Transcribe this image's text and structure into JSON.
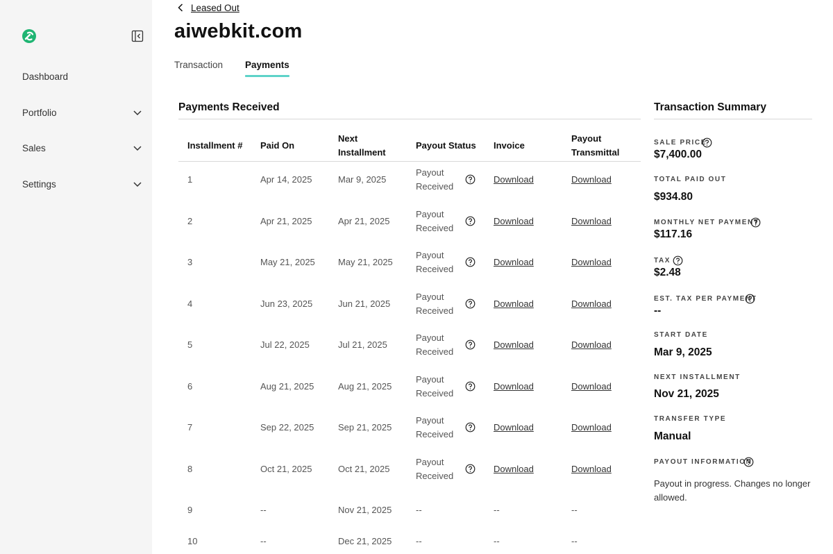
{
  "sidebar": {
    "collapse_icon": "sidebar-collapse-icon",
    "items": [
      {
        "label": "Dashboard",
        "has_chevron": false
      },
      {
        "label": "Portfolio",
        "has_chevron": true
      },
      {
        "label": "Sales",
        "has_chevron": true
      },
      {
        "label": "Settings",
        "has_chevron": true
      }
    ]
  },
  "header": {
    "back_label": "Leased Out",
    "title": "aiwebkit.com",
    "tabs": [
      {
        "label": "Transaction",
        "active": false
      },
      {
        "label": "Payments",
        "active": true
      }
    ]
  },
  "payments": {
    "title": "Payments Received",
    "columns": {
      "installment": "Installment #",
      "paid_on": "Paid On",
      "next_installment_1": "Next",
      "next_installment_2": "Installment",
      "payout_status": "Payout Status",
      "invoice": "Invoice",
      "payout_transmittal_1": "Payout",
      "payout_transmittal_2": "Transmittal"
    },
    "rows": [
      {
        "num": "1",
        "paid_on": "Apr 14, 2025",
        "next": "Mar 9, 2025",
        "status_1": "Payout",
        "status_2": "Received",
        "invoice": "Download",
        "transmittal": "Download"
      },
      {
        "num": "2",
        "paid_on": "Apr 21, 2025",
        "next": "Apr 21, 2025",
        "status_1": "Payout",
        "status_2": "Received",
        "invoice": "Download",
        "transmittal": "Download"
      },
      {
        "num": "3",
        "paid_on": "May 21, 2025",
        "next": "May 21, 2025",
        "status_1": "Payout",
        "status_2": "Received",
        "invoice": "Download",
        "transmittal": "Download"
      },
      {
        "num": "4",
        "paid_on": "Jun 23, 2025",
        "next": "Jun 21, 2025",
        "status_1": "Payout",
        "status_2": "Received",
        "invoice": "Download",
        "transmittal": "Download"
      },
      {
        "num": "5",
        "paid_on": "Jul 22, 2025",
        "next": "Jul 21, 2025",
        "status_1": "Payout",
        "status_2": "Received",
        "invoice": "Download",
        "transmittal": "Download"
      },
      {
        "num": "6",
        "paid_on": "Aug 21, 2025",
        "next": "Aug 21, 2025",
        "status_1": "Payout",
        "status_2": "Received",
        "invoice": "Download",
        "transmittal": "Download"
      },
      {
        "num": "7",
        "paid_on": "Sep 22, 2025",
        "next": "Sep 21, 2025",
        "status_1": "Payout",
        "status_2": "Received",
        "invoice": "Download",
        "transmittal": "Download"
      },
      {
        "num": "8",
        "paid_on": "Oct 21, 2025",
        "next": "Oct 21, 2025",
        "status_1": "Payout",
        "status_2": "Received",
        "invoice": "Download",
        "transmittal": "Download"
      },
      {
        "num": "9",
        "paid_on": "--",
        "next": "Nov 21, 2025",
        "status_1": "--",
        "status_2": "",
        "invoice": "--",
        "transmittal": "--"
      },
      {
        "num": "10",
        "paid_on": "--",
        "next": "Dec 21, 2025",
        "status_1": "--",
        "status_2": "",
        "invoice": "--",
        "transmittal": "--"
      }
    ]
  },
  "summary": {
    "title": "Transaction Summary",
    "sale_price_label": "Sale Price",
    "sale_price": "$7,400.00",
    "total_paid_out_label": "Total Paid Out",
    "total_paid_out": "$934.80",
    "monthly_net_label": "Monthly Net Payment",
    "monthly_net": "$117.16",
    "tax_label": "Tax",
    "tax": "$2.48",
    "est_tax_label": "Est. Tax Per Payment",
    "est_tax": "--",
    "start_date_label": "Start Date",
    "start_date": "Mar 9, 2025",
    "next_installment_label": "Next Installment",
    "next_installment": "Nov 21, 2025",
    "transfer_type_label": "Transfer Type",
    "transfer_type": "Manual",
    "payout_info_label": "Payout Information",
    "payout_info": "Payout in progress. Changes no longer allowed."
  },
  "colors": {
    "sidebar_bg": "#f5f5f5",
    "tab_underline": "#5ed3c9",
    "logo_green": "#1fb573"
  }
}
